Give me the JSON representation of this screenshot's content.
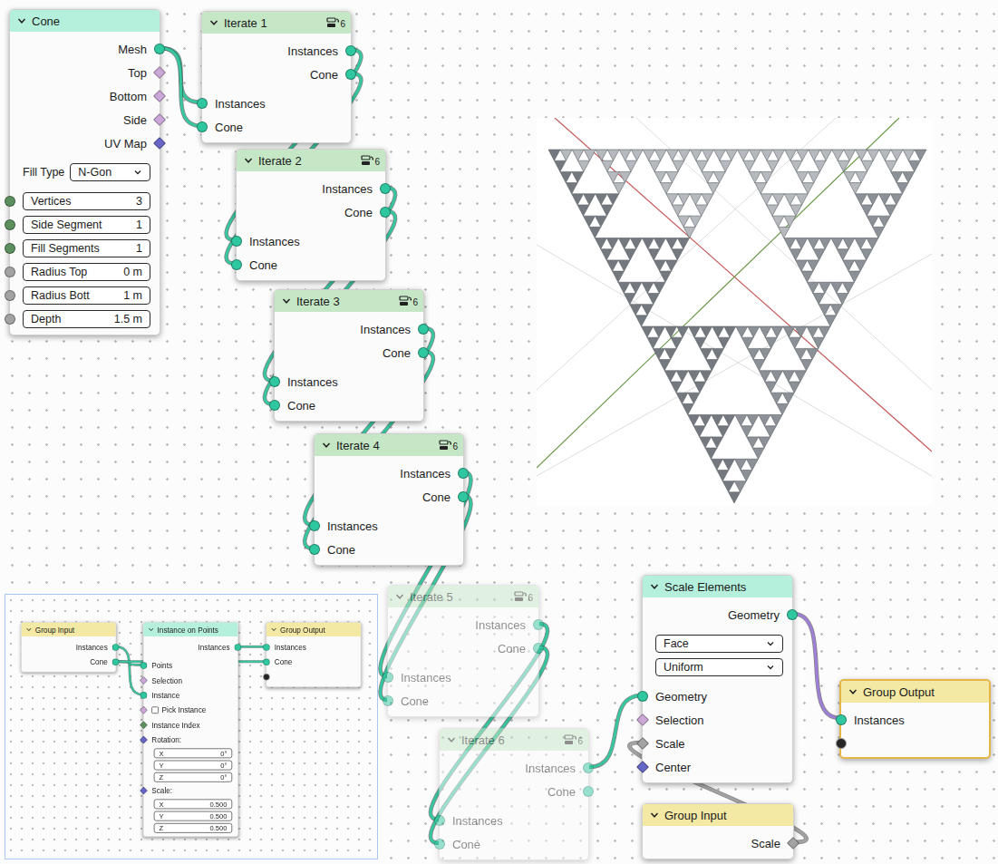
{
  "nodes": [
    {
      "title": "Cone",
      "kind": "geometry",
      "selected": false,
      "dimmed": false,
      "outputs": [
        {
          "label": "Mesh",
          "socket": "geometry"
        },
        {
          "label": "Top",
          "socket": "bool-field"
        },
        {
          "label": "Bottom",
          "socket": "bool-field"
        },
        {
          "label": "Side",
          "socket": "bool-field"
        },
        {
          "label": "UV Map",
          "socket": "vector-field"
        }
      ],
      "dropdowns": [
        {
          "label": "Fill Type",
          "value": "N-Gon"
        }
      ],
      "inputs": [
        {
          "label": "Vertices",
          "value": "3",
          "socket": "int",
          "kind": "field"
        },
        {
          "label": "Side Segment",
          "value": "1",
          "socket": "int",
          "kind": "field"
        },
        {
          "label": "Fill Segments",
          "value": "1",
          "socket": "int",
          "kind": "field"
        },
        {
          "label": "Radius Top",
          "value": "0 m",
          "socket": "float",
          "kind": "field"
        },
        {
          "label": "Radius Bott",
          "value": "1 m",
          "socket": "float",
          "kind": "field"
        },
        {
          "label": "Depth",
          "value": "1.5 m",
          "socket": "float",
          "kind": "field"
        }
      ]
    },
    {
      "title": "Iterate 1",
      "kind": "group",
      "badge": "6",
      "selected": false,
      "dimmed": false,
      "outputs": [
        {
          "label": "Instances",
          "socket": "geometry"
        },
        {
          "label": "Cone",
          "socket": "geometry"
        }
      ],
      "inputs": [
        {
          "label": "Instances",
          "socket": "geometry",
          "kind": "label"
        },
        {
          "label": "Cone",
          "socket": "geometry",
          "kind": "label"
        }
      ]
    },
    {
      "title": "Iterate 2",
      "kind": "group",
      "badge": "6",
      "selected": false,
      "dimmed": false,
      "outputs": [
        {
          "label": "Instances",
          "socket": "geometry"
        },
        {
          "label": "Cone",
          "socket": "geometry"
        }
      ],
      "inputs": [
        {
          "label": "Instances",
          "socket": "geometry",
          "kind": "label"
        },
        {
          "label": "Cone",
          "socket": "geometry",
          "kind": "label"
        }
      ]
    },
    {
      "title": "Iterate 3",
      "kind": "group",
      "badge": "6",
      "selected": false,
      "dimmed": false,
      "outputs": [
        {
          "label": "Instances",
          "socket": "geometry"
        },
        {
          "label": "Cone",
          "socket": "geometry"
        }
      ],
      "inputs": [
        {
          "label": "Instances",
          "socket": "geometry",
          "kind": "label"
        },
        {
          "label": "Cone",
          "socket": "geometry",
          "kind": "label"
        }
      ]
    },
    {
      "title": "Iterate 4",
      "kind": "group",
      "badge": "6",
      "selected": false,
      "dimmed": false,
      "outputs": [
        {
          "label": "Instances",
          "socket": "geometry"
        },
        {
          "label": "Cone",
          "socket": "geometry"
        }
      ],
      "inputs": [
        {
          "label": "Instances",
          "socket": "geometry",
          "kind": "label"
        },
        {
          "label": "Cone",
          "socket": "geometry",
          "kind": "label"
        }
      ]
    },
    {
      "title": "Iterate 5",
      "kind": "group",
      "badge": "6",
      "selected": false,
      "dimmed": true,
      "outputs": [
        {
          "label": "Instances",
          "socket": "geometry"
        },
        {
          "label": "Cone",
          "socket": "geometry"
        }
      ],
      "inputs": [
        {
          "label": "Instances",
          "socket": "geometry",
          "kind": "label"
        },
        {
          "label": "Cone",
          "socket": "geometry",
          "kind": "label"
        }
      ]
    },
    {
      "title": "Iterate 6",
      "kind": "group",
      "badge": "6",
      "selected": false,
      "dimmed": true,
      "outputs": [
        {
          "label": "Instances",
          "socket": "geometry"
        },
        {
          "label": "Cone",
          "socket": "geometry"
        }
      ],
      "inputs": [
        {
          "label": "Instances",
          "socket": "geometry",
          "kind": "label"
        },
        {
          "label": "Cone",
          "socket": "geometry",
          "kind": "label"
        }
      ]
    },
    {
      "title": "Scale Elements",
      "kind": "geometry",
      "selected": false,
      "dimmed": false,
      "outputs": [
        {
          "label": "Geometry",
          "socket": "geometry"
        }
      ],
      "dropdowns": [
        {
          "value": "Face"
        },
        {
          "value": "Uniform"
        }
      ],
      "inputs": [
        {
          "label": "Geometry",
          "socket": "geometry",
          "kind": "label"
        },
        {
          "label": "Selection",
          "socket": "bool-field",
          "kind": "label"
        },
        {
          "label": "Scale",
          "socket": "float-field",
          "kind": "label"
        },
        {
          "label": "Center",
          "socket": "vector-field",
          "kind": "label"
        }
      ]
    },
    {
      "title": "Group Output",
      "kind": "io",
      "selected": true,
      "dimmed": false,
      "outputs": [],
      "inputs": [
        {
          "label": "Instances",
          "socket": "geometry",
          "kind": "label"
        },
        {
          "label": "",
          "socket": "empty",
          "kind": "label"
        }
      ]
    },
    {
      "title": "Group Input",
      "kind": "io",
      "selected": false,
      "dimmed": false,
      "outputs": [
        {
          "label": "Scale",
          "socket": "float-field"
        }
      ],
      "inputs": []
    }
  ],
  "links": [
    {
      "from": "Cone",
      "out": "Mesh",
      "to": "Iterate 1",
      "in": "Instances",
      "selected": false
    },
    {
      "from": "Cone",
      "out": "Mesh",
      "to": "Iterate 1",
      "in": "Cone",
      "selected": false
    },
    {
      "from": "Iterate 1",
      "out": "Instances",
      "to": "Iterate 2",
      "in": "Instances",
      "selected": false
    },
    {
      "from": "Iterate 1",
      "out": "Cone",
      "to": "Iterate 2",
      "in": "Cone",
      "selected": false
    },
    {
      "from": "Iterate 2",
      "out": "Instances",
      "to": "Iterate 3",
      "in": "Instances",
      "selected": false
    },
    {
      "from": "Iterate 2",
      "out": "Cone",
      "to": "Iterate 3",
      "in": "Cone",
      "selected": false
    },
    {
      "from": "Iterate 3",
      "out": "Instances",
      "to": "Iterate 4",
      "in": "Instances",
      "selected": false
    },
    {
      "from": "Iterate 3",
      "out": "Cone",
      "to": "Iterate 4",
      "in": "Cone",
      "selected": false
    },
    {
      "from": "Iterate 4",
      "out": "Instances",
      "to": "Iterate 5",
      "in": "Instances",
      "selected": false
    },
    {
      "from": "Iterate 4",
      "out": "Cone",
      "to": "Iterate 5",
      "in": "Cone",
      "selected": false
    },
    {
      "from": "Iterate 5",
      "out": "Instances",
      "to": "Iterate 6",
      "in": "Instances",
      "selected": false
    },
    {
      "from": "Iterate 5",
      "out": "Cone",
      "to": "Iterate 6",
      "in": "Cone",
      "selected": false
    },
    {
      "from": "Iterate 6",
      "out": "Instances",
      "to": "Scale Elements",
      "in": "Geometry",
      "selected": false
    },
    {
      "from": "Scale Elements",
      "out": "Geometry",
      "to": "Group Output",
      "in": "Instances",
      "selected": true
    },
    {
      "from": "Group Input",
      "out": "Scale",
      "to": "Scale Elements",
      "in": "Scale",
      "selected": false
    }
  ],
  "inset": {
    "nodes": [
      {
        "title": "Group Input",
        "kind": "io",
        "selected": false,
        "dimmed": false,
        "outputs": [
          {
            "label": "Instances",
            "socket": "geometry"
          },
          {
            "label": "Cone",
            "socket": "geometry"
          }
        ],
        "inputs": []
      },
      {
        "title": "Instance on Points",
        "kind": "geometry",
        "selected": false,
        "dimmed": false,
        "outputs": [
          {
            "label": "Instances",
            "socket": "geometry"
          }
        ],
        "inputs": [
          {
            "label": "Points",
            "socket": "geometry",
            "kind": "label"
          },
          {
            "label": "Selection",
            "socket": "bool-field",
            "kind": "label"
          },
          {
            "label": "Instance",
            "socket": "geometry",
            "kind": "label"
          },
          {
            "label": "Pick Instance",
            "socket": "bool-field",
            "kind": "check",
            "checked": false
          },
          {
            "label": "Instance Index",
            "socket": "int-field",
            "kind": "label"
          },
          {
            "label": "Rotation:",
            "socket": "vector-field",
            "kind": "label"
          },
          {
            "label": "X",
            "value": "0°",
            "kind": "component"
          },
          {
            "label": "Y",
            "value": "0°",
            "kind": "component"
          },
          {
            "label": "Z",
            "value": "0°",
            "kind": "component"
          },
          {
            "label": "Scale:",
            "socket": "vector-field",
            "kind": "label"
          },
          {
            "label": "X",
            "value": "0.500",
            "kind": "component"
          },
          {
            "label": "Y",
            "value": "0.500",
            "kind": "component"
          },
          {
            "label": "Z",
            "value": "0.500",
            "kind": "component"
          }
        ]
      },
      {
        "title": "Group Output",
        "kind": "io",
        "selected": false,
        "dimmed": false,
        "outputs": [],
        "inputs": [
          {
            "label": "Instances",
            "socket": "geometry",
            "kind": "label"
          },
          {
            "label": "Cone",
            "socket": "geometry",
            "kind": "label"
          },
          {
            "label": "",
            "socket": "empty",
            "kind": "label"
          }
        ]
      }
    ],
    "links": [
      {
        "from": "Group Input",
        "out": "Instances",
        "to": "Instance on Points",
        "in": "Instance",
        "selected": false
      },
      {
        "from": "Group Input",
        "out": "Cone",
        "to": "Instance on Points",
        "in": "Points",
        "selected": false
      },
      {
        "from": "Group Input",
        "out": "Cone",
        "to": "Group Output",
        "in": "Cone",
        "selected": false
      },
      {
        "from": "Instance on Points",
        "out": "Instances",
        "to": "Group Output",
        "in": "Instances",
        "selected": false
      }
    ]
  }
}
